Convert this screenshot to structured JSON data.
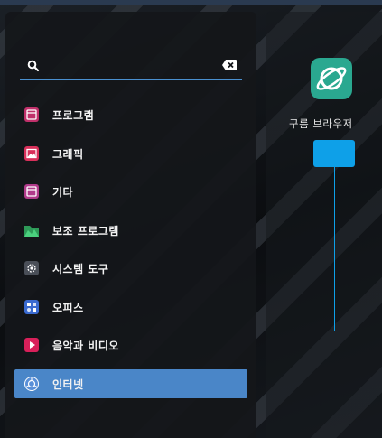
{
  "search": {
    "value": "",
    "placeholder": ""
  },
  "categories": [
    {
      "label": "프로그램",
      "icon": "programs-icon",
      "color": "#c0306a"
    },
    {
      "label": "그래픽",
      "icon": "graphics-icon",
      "color": "#d8305a"
    },
    {
      "label": "기타",
      "icon": "other-icon",
      "color": "#b03a8a"
    },
    {
      "label": "보조 프로그램",
      "icon": "accessories-icon",
      "color": "#3cba6a"
    },
    {
      "label": "시스템 도구",
      "icon": "system-tools-icon",
      "color": "#4a4f58"
    },
    {
      "label": "오피스",
      "icon": "office-icon",
      "color": "#3a6ad0"
    },
    {
      "label": "음악과 비디오",
      "icon": "multimedia-icon",
      "color": "#d8205a"
    },
    {
      "label": "인터넷",
      "icon": "internet-icon",
      "color": "#6aa0e0"
    }
  ],
  "selected_category": "인터넷",
  "apps": [
    {
      "name": "구름 브라우저",
      "icon": "gooroom-browser-icon",
      "color": "#2aa890"
    }
  ],
  "colors": {
    "accent": "#4a86c8",
    "highlight": "#0ea0e8"
  }
}
